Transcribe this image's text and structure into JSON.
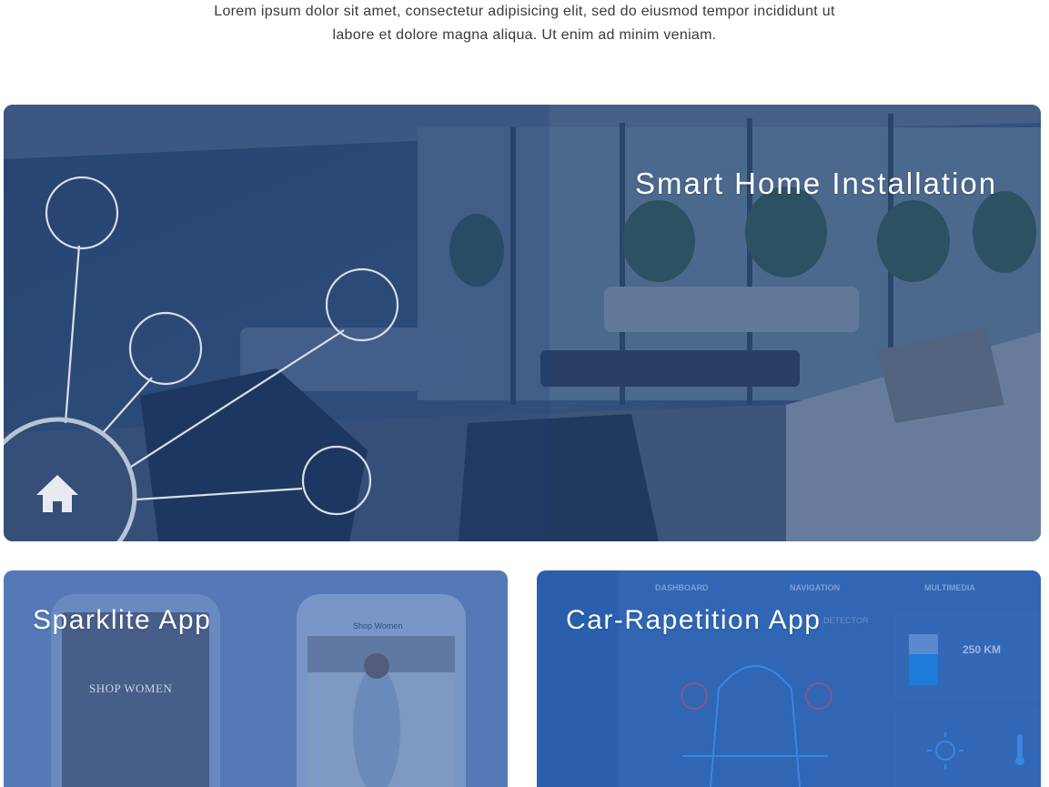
{
  "intro": {
    "line1": "Lorem ipsum dolor sit amet, consectetur adipisicing elit, sed do eiusmod tempor incididunt ut",
    "line2": "labore et dolore magna aliqua. Ut enim ad minim veniam."
  },
  "projects": [
    {
      "title": "Smart Home Installation",
      "icon": "home-icon"
    },
    {
      "title": "Sparklite App",
      "phone_left_text": "SHOP WOMEN",
      "phone_right_header": "Shop Women"
    },
    {
      "title": "Car-Rapetition App",
      "tabs": [
        "DASHBOARD",
        "NAVIGATION",
        "MULTIMEDIA"
      ],
      "sub_tab": "DETECTOR",
      "range": "250 KM"
    }
  ],
  "colors": {
    "overlay_main": "#1e3f73",
    "overlay_left": "#4a74b4",
    "overlay_right": "#2462b4"
  }
}
